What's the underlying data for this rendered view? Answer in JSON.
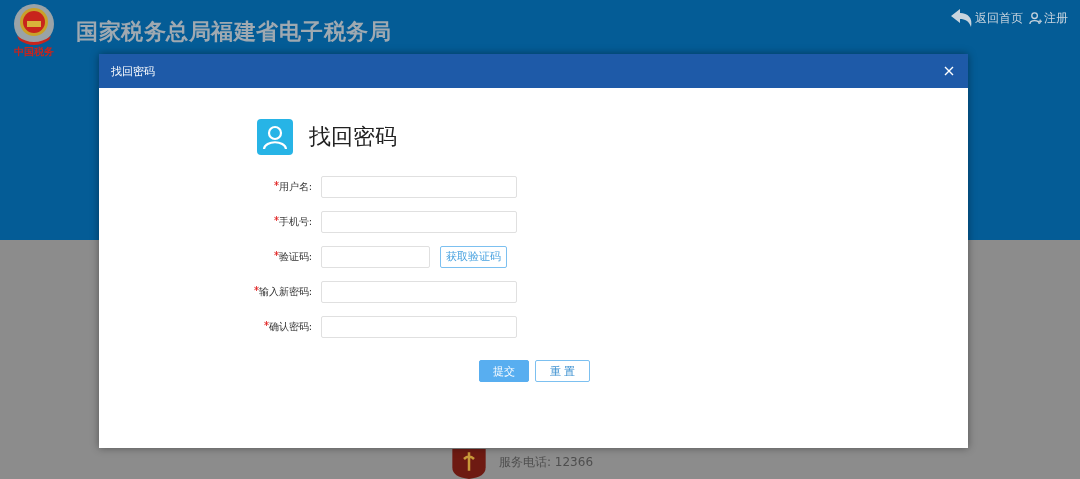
{
  "header": {
    "logo_caption": "中国税务",
    "title": "国家税务总局福建省电子税务局",
    "links": [
      {
        "label": "返回首页",
        "kind": "back"
      },
      {
        "label": "注册",
        "kind": "register"
      }
    ]
  },
  "footer": {
    "phone": "服务电话: 12366"
  },
  "dialog": {
    "title": "找回密码",
    "heading": "找回密码",
    "fields": [
      {
        "label": "用户名:",
        "required": true,
        "kind": "input"
      },
      {
        "label": "手机号:",
        "required": true,
        "kind": "input"
      },
      {
        "label": "验证码:",
        "required": true,
        "kind": "code",
        "button": "获取验证码"
      },
      {
        "label": "输入新密码:",
        "required": true,
        "kind": "input"
      },
      {
        "label": "确认密码:",
        "required": true,
        "kind": "input"
      }
    ],
    "actions": [
      {
        "label": "提交",
        "kind": "primary"
      },
      {
        "label": "重 置",
        "kind": "secondary"
      }
    ]
  }
}
